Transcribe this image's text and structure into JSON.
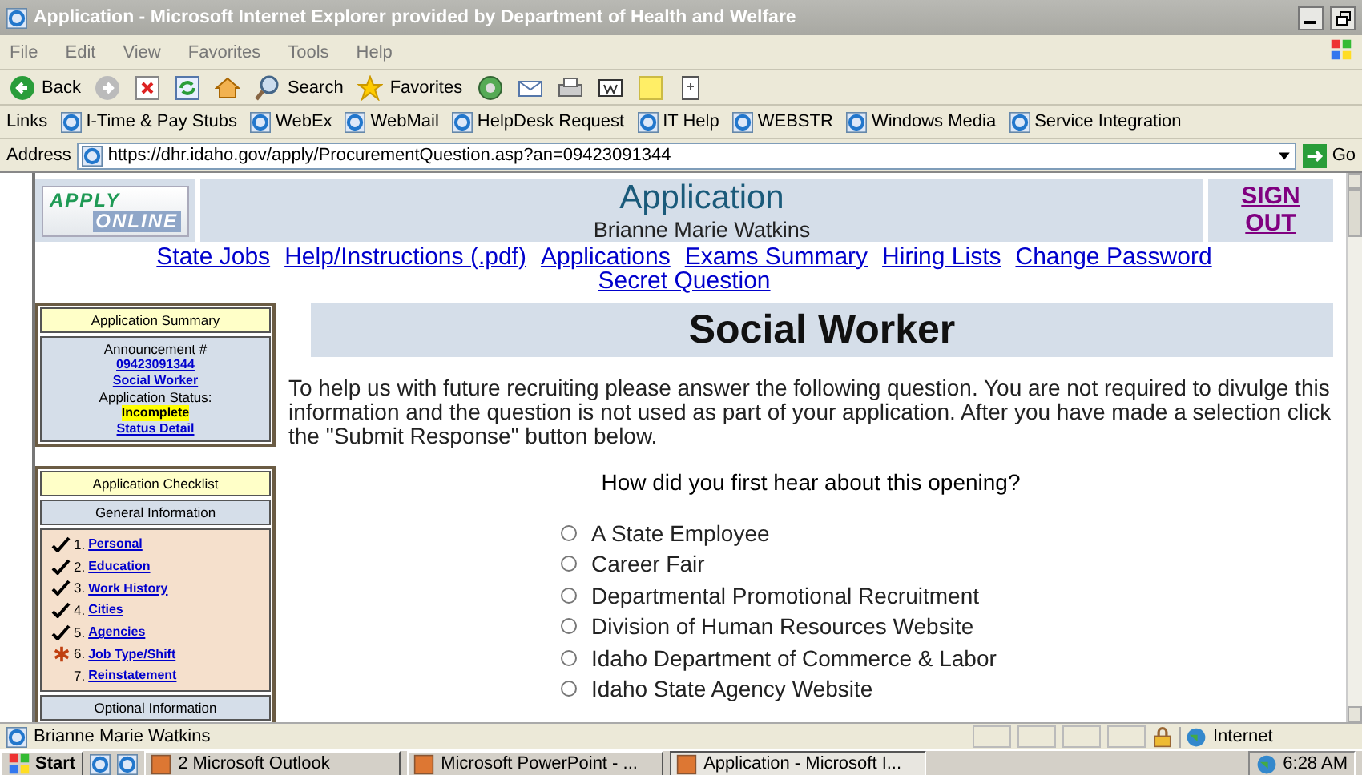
{
  "window": {
    "title": "Application - Microsoft Internet Explorer provided by Department of Health and Welfare"
  },
  "menu": [
    "File",
    "Edit",
    "View",
    "Favorites",
    "Tools",
    "Help"
  ],
  "toolbar": [
    {
      "kind": "back",
      "label": "Back"
    },
    {
      "kind": "forward"
    },
    {
      "kind": "stop"
    },
    {
      "kind": "refresh"
    },
    {
      "kind": "home"
    },
    {
      "kind": "search",
      "label": "Search"
    },
    {
      "kind": "favorites",
      "label": "Favorites"
    },
    {
      "kind": "media"
    },
    {
      "kind": "mail"
    },
    {
      "kind": "print"
    },
    {
      "kind": "edit"
    },
    {
      "kind": "note"
    },
    {
      "kind": "messenger"
    }
  ],
  "links_bar": {
    "label": "Links",
    "items": [
      "I-Time & Pay Stubs",
      "WebEx",
      "WebMail",
      "HelpDesk Request",
      "IT Help",
      "WEBSTR",
      "Windows Media",
      "Service Integration"
    ]
  },
  "address_bar": {
    "label": "Address",
    "url": "https://dhr.idaho.gov/apply/ProcurementQuestion.asp?an=09423091344",
    "go": "Go"
  },
  "page": {
    "logo": [
      "APPLY",
      "ONLINE"
    ],
    "header": {
      "title": "Application",
      "user": "Brianne Marie Watkins",
      "sign_out": "SIGN OUT"
    },
    "nav": [
      "State Jobs",
      "Help/Instructions (.pdf)",
      "Applications",
      "Exams Summary",
      "Hiring Lists",
      "Change Password",
      "Secret Question"
    ],
    "summary": {
      "title": "Application Summary",
      "lines": [
        {
          "kind": "text",
          "text": "Announcement #"
        },
        {
          "kind": "link",
          "text": "09423091344"
        },
        {
          "kind": "link",
          "text": "Social Worker"
        },
        {
          "kind": "text",
          "text": "Application Status:"
        },
        {
          "kind": "badge",
          "text": "Incomplete"
        },
        {
          "kind": "link",
          "text": "Status Detail"
        }
      ]
    },
    "checklist": {
      "title": "Application Checklist",
      "sections": [
        {
          "heading": "General Information",
          "items": [
            {
              "number": "1.",
              "label": "Personal",
              "kind": "done"
            },
            {
              "number": "2.",
              "label": "Education",
              "kind": "done"
            },
            {
              "number": "3.",
              "label": "Work History",
              "kind": "done"
            },
            {
              "number": "4.",
              "label": "Cities",
              "kind": "done"
            },
            {
              "number": "5.",
              "label": "Agencies",
              "kind": "done"
            },
            {
              "number": "6.",
              "label": "Job Type/Shift",
              "kind": "pending"
            },
            {
              "number": "7.",
              "label": "Reinstatement",
              "kind": "blank"
            }
          ]
        },
        {
          "heading": "Optional Information"
        }
      ]
    },
    "job_title": "Social Worker",
    "intro": "To help us with future recruiting please answer the following question. You are not required to divulge this information and the question is not used as part of your application. After you have made a selection click the \"Submit Response\" button below.",
    "question": "How did you first hear about this opening?",
    "options": [
      {
        "label": "A State Employee",
        "selected": false
      },
      {
        "label": "Career Fair",
        "selected": false
      },
      {
        "label": "Departmental Promotional Recruitment",
        "selected": false
      },
      {
        "label": "Division of Human Resources Website",
        "selected": false
      },
      {
        "label": "Idaho Department of Commerce & Labor",
        "selected": false
      },
      {
        "label": "Idaho State Agency Website",
        "selected": false
      }
    ]
  },
  "status_bar": {
    "text": "Brianne Marie Watkins",
    "zone": "Internet"
  },
  "taskbar": {
    "start": "Start",
    "tasks": [
      {
        "label": "2 Microsoft Outlook",
        "selected": false
      },
      {
        "label": "Microsoft PowerPoint - ...",
        "selected": false
      },
      {
        "label": "Application - Microsoft I...",
        "selected": true
      }
    ],
    "clock": "6:28 AM"
  }
}
